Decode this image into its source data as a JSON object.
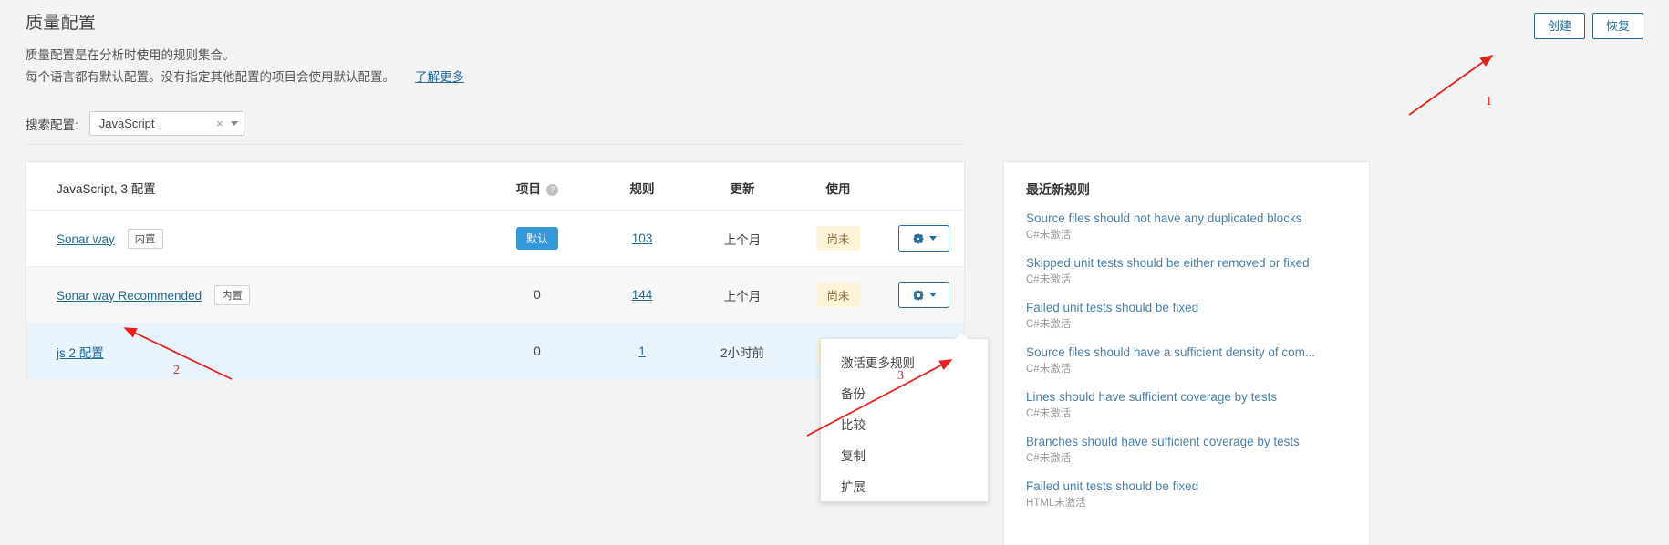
{
  "header": {
    "title": "质量配置",
    "desc_line1": "质量配置是在分析时使用的规则集合。",
    "desc_line2": "每个语言都有默认配置。没有指定其他配置的项目会使用默认配置。",
    "learn_more": "了解更多",
    "create_button": "创建",
    "restore_button": "恢复"
  },
  "search": {
    "label": "搜索配置:",
    "value": "JavaScript",
    "clear_icon": "×",
    "caret_icon": "chevron-down-icon"
  },
  "table": {
    "caption": "JavaScript, 3 配置",
    "columns": {
      "name": "JavaScript, 3 配置",
      "projects": "项目",
      "rules": "规则",
      "updated": "更新",
      "usage": "使用"
    },
    "rows": [
      {
        "name": "Sonar way",
        "tag": "内置",
        "projects": "默认",
        "projects_is_badge": true,
        "rules": "103",
        "updated": "上个月",
        "usage": "尚未",
        "menu_open": false
      },
      {
        "name": "Sonar way Recommended",
        "tag": "内置",
        "projects": "0",
        "projects_is_badge": false,
        "rules": "144",
        "updated": "上个月",
        "usage": "尚未",
        "menu_open": false
      },
      {
        "name": "js 2 配置",
        "tag": "",
        "projects": "0",
        "projects_is_badge": false,
        "rules": "1",
        "updated": "2小时前",
        "usage": "尚未",
        "menu_open": true
      }
    ]
  },
  "dropdown": {
    "items": [
      "激活更多规则",
      "备份",
      "比较",
      "复制",
      "扩展"
    ]
  },
  "sidebar": {
    "title": "最近新规则",
    "rules": [
      {
        "name": "Source files should not have any duplicated blocks",
        "meta": "C#未激活"
      },
      {
        "name": "Skipped unit tests should be either removed or fixed",
        "meta": "C#未激活"
      },
      {
        "name": "Failed unit tests should be fixed",
        "meta": "C#未激活"
      },
      {
        "name": "Source files should have a sufficient density of com...",
        "meta": "C#未激活"
      },
      {
        "name": "Lines should have sufficient coverage by tests",
        "meta": "C#未激活"
      },
      {
        "name": "Branches should have sufficient coverage by tests",
        "meta": "C#未激活"
      },
      {
        "name": "Failed unit tests should be fixed",
        "meta": "HTML未激活"
      }
    ]
  },
  "annotations": {
    "labels": [
      "1",
      "2",
      "3"
    ],
    "color": "#e8221a"
  }
}
